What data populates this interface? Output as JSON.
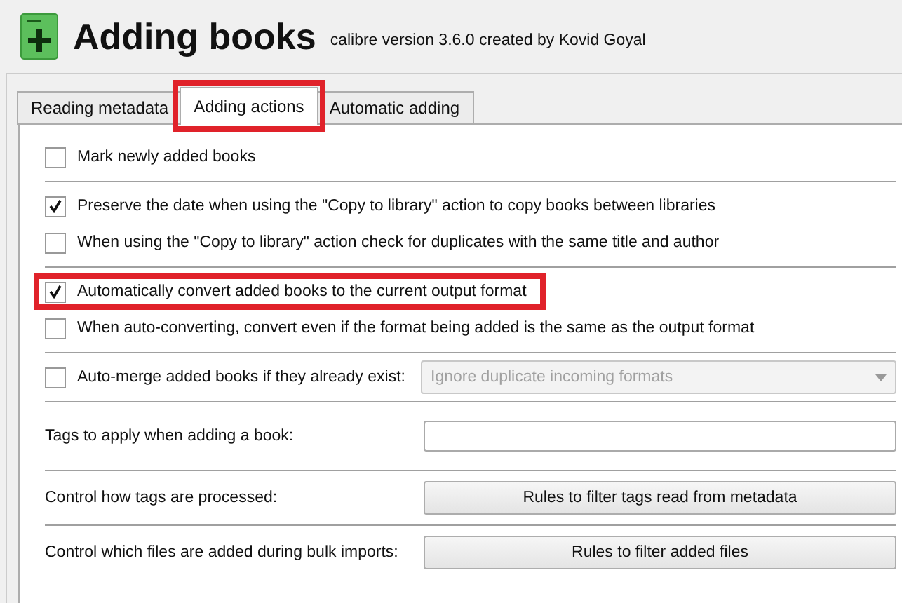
{
  "header": {
    "title": "Adding books",
    "subtitle": "calibre version 3.6.0 created by Kovid Goyal"
  },
  "tabs": [
    {
      "label": "Reading metadata",
      "selected": false,
      "highlighted": false
    },
    {
      "label": "Adding actions",
      "selected": true,
      "highlighted": true
    },
    {
      "label": "Automatic adding",
      "selected": false,
      "highlighted": false
    }
  ],
  "sections": [
    {
      "rows": [
        {
          "kind": "checkbox",
          "label": "Mark newly added books",
          "checked": false,
          "highlighted": false
        }
      ]
    },
    {
      "rows": [
        {
          "kind": "checkbox",
          "label": "Preserve the date when using the \"Copy to library\" action to copy books between libraries",
          "checked": true,
          "highlighted": false
        },
        {
          "kind": "checkbox",
          "label": "When using the \"Copy to library\" action check for duplicates with the same title and author",
          "checked": false,
          "highlighted": false
        }
      ]
    },
    {
      "rows": [
        {
          "kind": "checkbox",
          "label": "Automatically convert added books to the current output format",
          "checked": true,
          "highlighted": true
        },
        {
          "kind": "checkbox",
          "label": "When auto-converting, convert even if the format being added is the same as the output format",
          "checked": false,
          "highlighted": false
        }
      ]
    },
    {
      "rows": [
        {
          "kind": "checkbox_select",
          "label": "Auto-merge added books if they already exist:",
          "checked": false,
          "value": "Ignore duplicate incoming formats",
          "disabled": true
        }
      ]
    },
    {
      "rows": [
        {
          "kind": "text_field",
          "label": "Tags to apply when adding a book:"
        }
      ]
    },
    {
      "rows": [
        {
          "kind": "button",
          "label": "Control how tags are processed:",
          "button": "Rules to filter tags read from metadata"
        }
      ]
    },
    {
      "rows": [
        {
          "kind": "button",
          "label": "Control which files are added during bulk imports:",
          "button": "Rules to filter added files"
        }
      ]
    }
  ]
}
